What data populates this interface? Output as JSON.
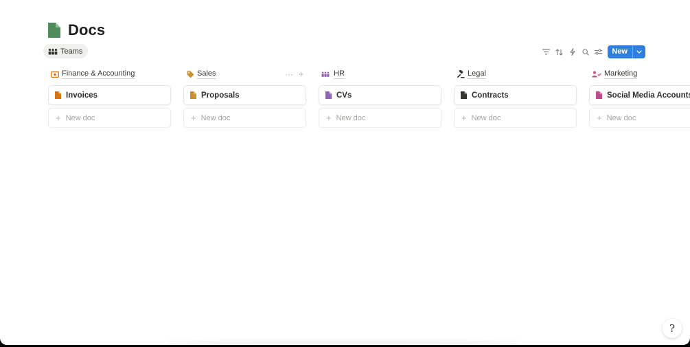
{
  "page": {
    "title": "Docs",
    "title_icon": "document-icon",
    "title_icon_color": "#4f8a5a"
  },
  "view_tab": {
    "label": "Teams",
    "icon": "people-group-icon"
  },
  "toolbar": {
    "icons": [
      "filter-icon",
      "sort-icon",
      "lightning-icon",
      "search-icon",
      "settings-sliders-icon"
    ],
    "new_label": "New",
    "accent_color": "#2f7fe0"
  },
  "columns": [
    {
      "name": "Finance & Accounting",
      "icon": "money-icon",
      "icon_color": "#d9730d",
      "cards": [
        {
          "title": "Invoices",
          "icon_color": "#d9730d"
        }
      ],
      "new_doc_label": "New doc"
    },
    {
      "name": "Sales",
      "icon": "tag-icon",
      "icon_color": "#cb912f",
      "cards": [
        {
          "title": "Proposals",
          "icon_color": "#cb912f"
        }
      ],
      "new_doc_label": "New doc",
      "actions": [
        "···",
        "+"
      ]
    },
    {
      "name": "HR",
      "icon": "people-group-icon",
      "icon_color": "#9065b0",
      "cards": [
        {
          "title": "CVs",
          "icon_color": "#9065b0"
        }
      ],
      "new_doc_label": "New doc"
    },
    {
      "name": "Legal",
      "icon": "gavel-icon",
      "icon_color": "#37352f",
      "cards": [
        {
          "title": "Contracts",
          "icon_color": "#37352f"
        }
      ],
      "new_doc_label": "New doc"
    },
    {
      "name": "Marketing",
      "icon": "person-check-icon",
      "icon_color": "#c14c8a",
      "cards": [
        {
          "title": "Social Media Accounts",
          "icon_color": "#c14c8a"
        }
      ],
      "new_doc_label": "New doc"
    }
  ],
  "help": {
    "icon": "help-icon"
  }
}
